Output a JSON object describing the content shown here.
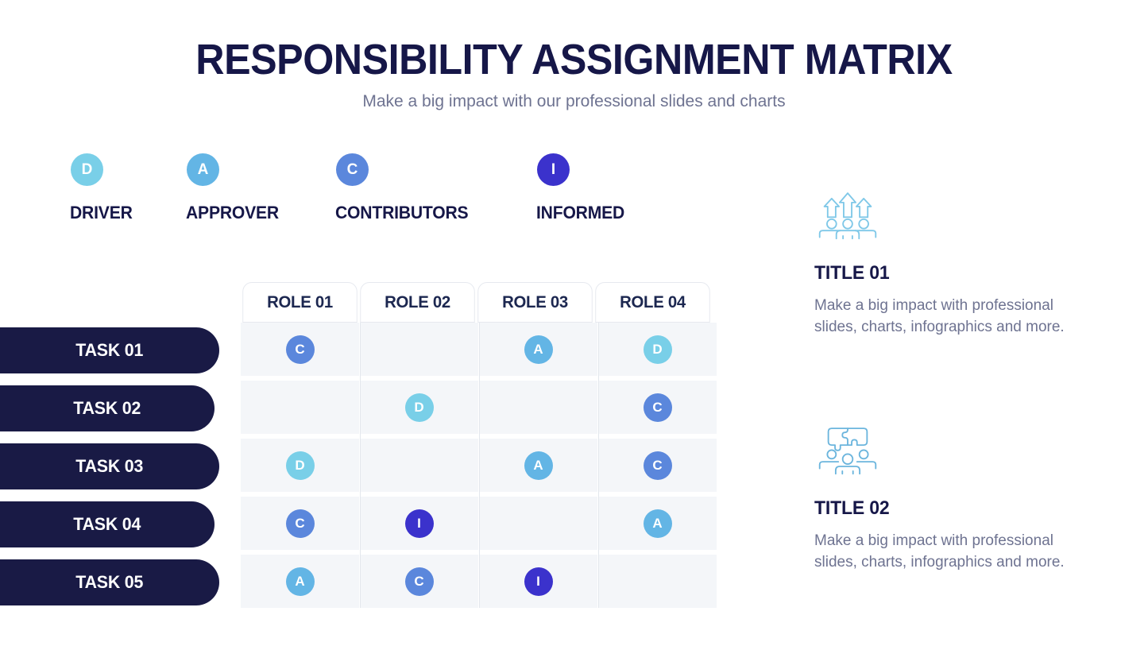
{
  "header": {
    "title": "RESPONSIBILITY ASSIGNMENT MATRIX",
    "subtitle": "Make a big impact with our professional slides and charts",
    "title_color": "#161748",
    "subtitle_color": "#6e7391"
  },
  "legend": {
    "items": [
      {
        "key": "D",
        "label": "DRIVER",
        "color": "#79cfe8"
      },
      {
        "key": "A",
        "label": "APPROVER",
        "color": "#63b5e5"
      },
      {
        "key": "C",
        "label": "CONTRIBUTORS",
        "color": "#5b87dc"
      },
      {
        "key": "I",
        "label": "INFORMED",
        "color": "#3b32cc"
      }
    ]
  },
  "matrix": {
    "columns": [
      "ROLE 01",
      "ROLE 02",
      "ROLE 03",
      "ROLE 04"
    ],
    "rows": [
      {
        "task": "TASK 01",
        "cells": [
          "C",
          "",
          "A",
          "D"
        ]
      },
      {
        "task": "TASK 02",
        "cells": [
          "",
          "D",
          "",
          "C"
        ]
      },
      {
        "task": "TASK 03",
        "cells": [
          "D",
          "",
          "A",
          "C"
        ]
      },
      {
        "task": "TASK 04",
        "cells": [
          "C",
          "I",
          "",
          "A"
        ]
      },
      {
        "task": "TASK 05",
        "cells": [
          "A",
          "C",
          "I",
          ""
        ]
      }
    ],
    "cell_background": "#f4f6f9",
    "separator_color": "#e3e7ed",
    "task_pill_color": "#191a45",
    "header_text_color": "#1c2750"
  },
  "features": [
    {
      "icon": "team-growth-arrows-icon",
      "icon_color": "#7fc8e8",
      "title": "TITLE 01",
      "description": "Make a big impact with professional slides, charts, infographics and more."
    },
    {
      "icon": "team-puzzle-collaboration-icon",
      "icon_color": "#6bb5dd",
      "title": "TITLE 02",
      "description": "Make a big impact with professional slides, charts, infographics and more."
    }
  ]
}
